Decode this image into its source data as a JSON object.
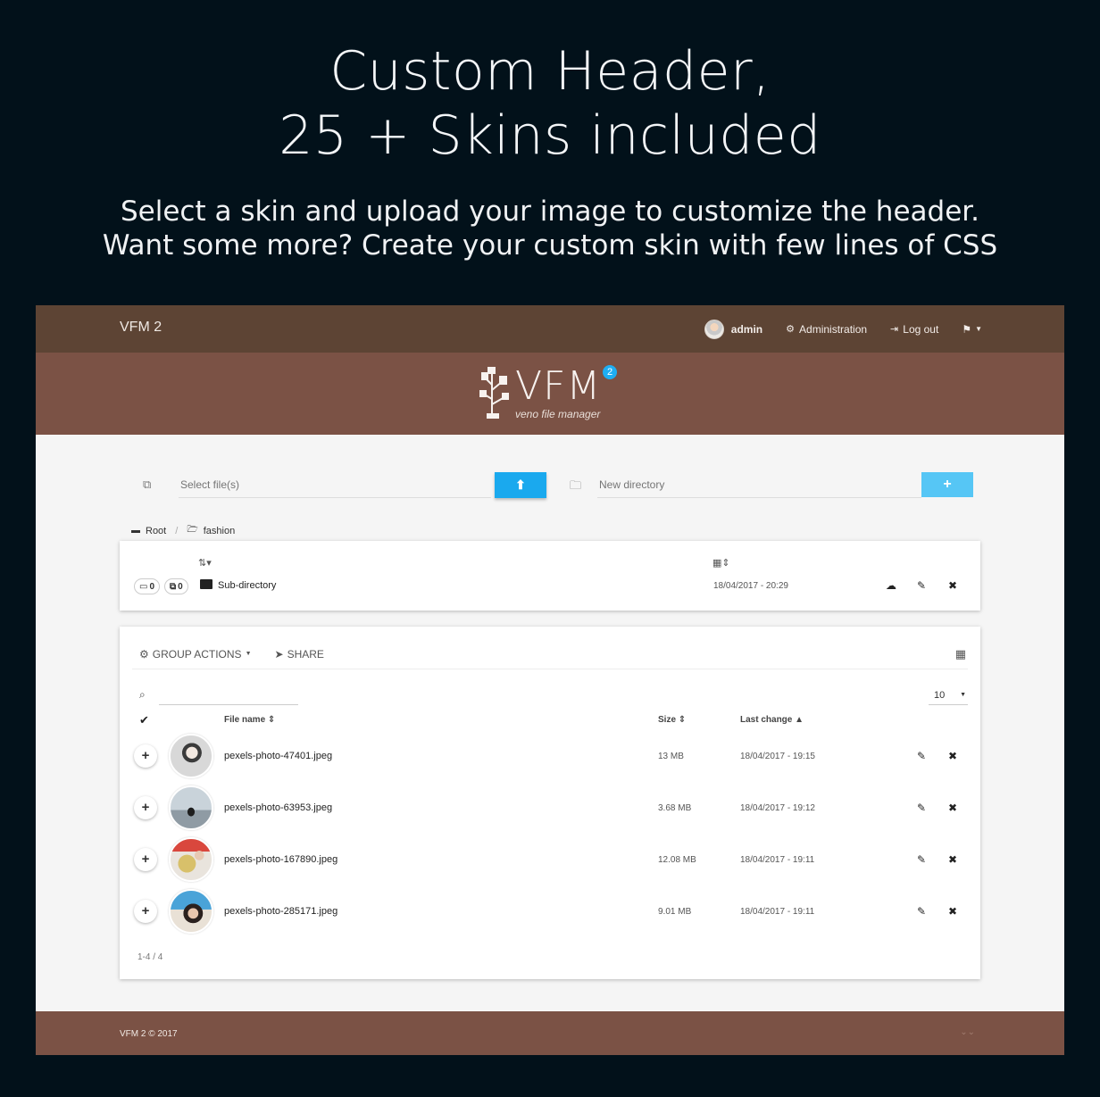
{
  "promo": {
    "title_line1": "Custom Header,",
    "title_line2": "25 + Skins included",
    "subtitle_line1": "Select a skin and upload your image to customize the header.",
    "subtitle_line2": "Want some more? Create your custom skin with few lines of CSS"
  },
  "navbar": {
    "brand": "VFM 2",
    "user": "admin",
    "administration": "Administration",
    "logout": "Log out"
  },
  "banner": {
    "logo_text": "VFM",
    "logo_badge": "2",
    "logo_tagline": "veno file manager"
  },
  "upload": {
    "file_placeholder": "Select file(s)",
    "dir_placeholder": "New directory"
  },
  "breadcrumb": {
    "root": "Root",
    "separator": "/",
    "current": "fashion"
  },
  "directories": {
    "rows": [
      {
        "folders": "0",
        "files": "0",
        "name": "Sub-directory",
        "date": "18/04/2017 - 20:29"
      }
    ]
  },
  "files": {
    "group_actions": "GROUP ACTIONS",
    "share": "SHARE",
    "page_size": "10",
    "columns": {
      "name": "File name",
      "size": "Size",
      "last_change": "Last change"
    },
    "rows": [
      {
        "name": "pexels-photo-47401.jpeg",
        "size": "13 MB",
        "date": "18/04/2017 - 19:15"
      },
      {
        "name": "pexels-photo-63953.jpeg",
        "size": "3.68 MB",
        "date": "18/04/2017 - 19:12"
      },
      {
        "name": "pexels-photo-167890.jpeg",
        "size": "12.08 MB",
        "date": "18/04/2017 - 19:11"
      },
      {
        "name": "pexels-photo-285171.jpeg",
        "size": "9.01 MB",
        "date": "18/04/2017 - 19:11"
      }
    ],
    "pagination": "1-4 / 4"
  },
  "footer": {
    "text": "VFM 2 © 2017"
  },
  "colors": {
    "navbar": "#5d4434",
    "banner": "#7b5245",
    "footer": "#7b5245",
    "accent": "#1aa9ee",
    "page_background": "#02111a"
  }
}
